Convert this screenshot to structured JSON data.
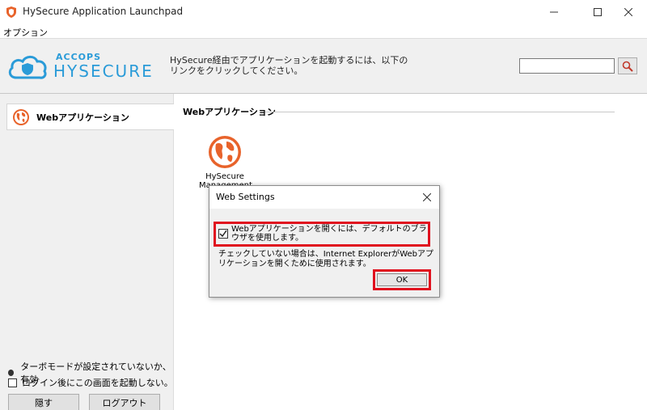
{
  "window": {
    "title": "HySecure Application Launchpad",
    "icon": "shield-icon"
  },
  "menu": {
    "options": "オプション"
  },
  "header": {
    "brand_top": "ACCOPS",
    "brand_main": "HYSECURE",
    "description": "HySecure経由でアプリケーションを起動するには、以下のリンクをクリックしてください。",
    "search_value": "",
    "accent_color": "#2a9bd8"
  },
  "sidebar": {
    "items": [
      {
        "label": "Webアプリケーション",
        "icon": "globe-icon"
      }
    ],
    "status_text": "ターボモードが設定されていないか、有効",
    "startup_checkbox_label": "ログイン後にこの画面を起動しない。",
    "hide_button": "隠す",
    "logout_button": "ログアウト"
  },
  "main": {
    "section_title": "Webアプリケーション",
    "apps": [
      {
        "name": "HySecure Management",
        "icon": "globe-icon"
      }
    ]
  },
  "dialog": {
    "title": "Web Settings",
    "checkbox_label": "Webアプリケーションを開くには、デフォルトのブラウザを使用します。",
    "checkbox_checked": true,
    "note": "チェックしていない場合は、Internet ExplorerがWebアプリケーションを開くために使用されます。",
    "ok_button": "OK",
    "highlight_color": "#e0101e"
  }
}
